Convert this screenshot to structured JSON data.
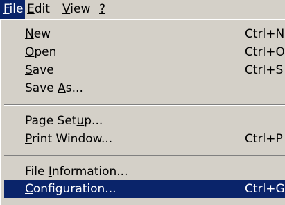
{
  "menubar": {
    "items": [
      {
        "name": "file",
        "pre": "",
        "mnemonic": "F",
        "post": "ile"
      },
      {
        "name": "edit",
        "pre": "",
        "mnemonic": "E",
        "post": "dit"
      },
      {
        "name": "view",
        "pre": "",
        "mnemonic": "V",
        "post": "iew"
      },
      {
        "name": "help",
        "pre": "",
        "mnemonic": "?",
        "post": ""
      }
    ]
  },
  "file_menu": {
    "items": [
      {
        "pre": "",
        "mnemonic": "N",
        "post": "ew",
        "shortcut": "Ctrl+N"
      },
      {
        "pre": "",
        "mnemonic": "O",
        "post": "pen",
        "shortcut": "Ctrl+O"
      },
      {
        "pre": "",
        "mnemonic": "S",
        "post": "ave",
        "shortcut": "Ctrl+S"
      },
      {
        "pre": "Save ",
        "mnemonic": "A",
        "post": "s...",
        "shortcut": ""
      },
      {
        "pre": "Page Set",
        "mnemonic": "u",
        "post": "p...",
        "shortcut": ""
      },
      {
        "pre": "",
        "mnemonic": "P",
        "post": "rint Window...",
        "shortcut": "Ctrl+P"
      },
      {
        "pre": "File ",
        "mnemonic": "I",
        "post": "nformation...",
        "shortcut": ""
      },
      {
        "pre": "",
        "mnemonic": "C",
        "post": "onfiguration...",
        "shortcut": "Ctrl+G"
      }
    ]
  },
  "colors": {
    "menu_bg": "#d4d0c8",
    "highlight": "#0a246a",
    "highlight_text": "#ffffff"
  }
}
